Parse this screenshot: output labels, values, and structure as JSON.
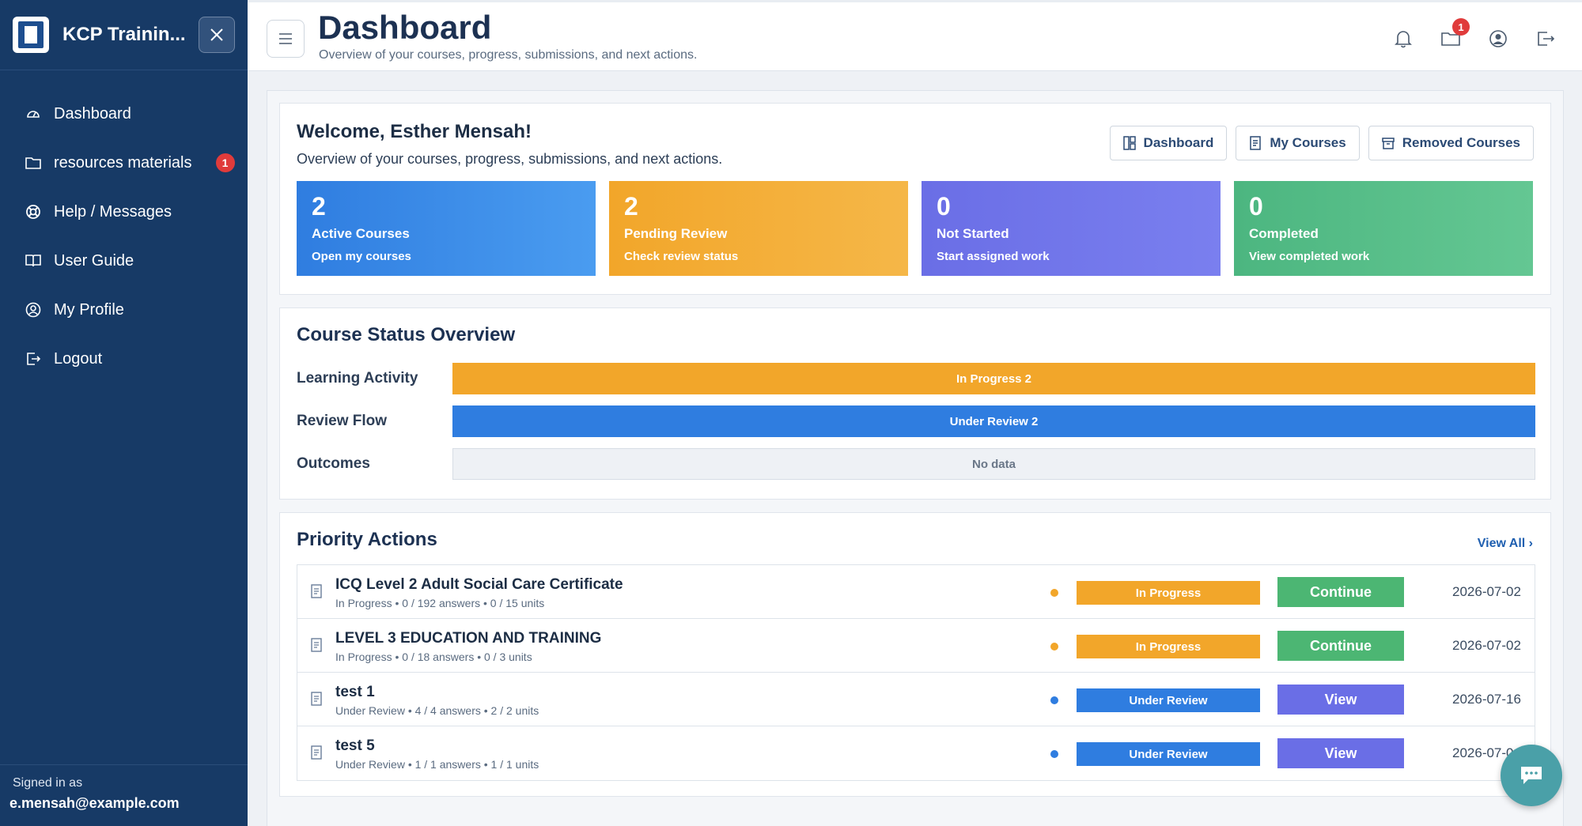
{
  "sidebar": {
    "brand": "KCP Trainin...",
    "items": [
      {
        "label": "Dashboard",
        "icon": "dashboard-icon"
      },
      {
        "label": "resources materials",
        "icon": "folder-icon",
        "badge": "1"
      },
      {
        "label": "Help / Messages",
        "icon": "lifebuoy-icon"
      },
      {
        "label": "User Guide",
        "icon": "book-icon"
      },
      {
        "label": "My Profile",
        "icon": "user-circle-icon"
      },
      {
        "label": "Logout",
        "icon": "logout-icon"
      }
    ],
    "signed_in_label": "Signed in as",
    "email": "e.mensah@example.com"
  },
  "header": {
    "title": "Dashboard",
    "subtitle": "Overview of your courses, progress, submissions, and next actions.",
    "folder_badge": "1"
  },
  "welcome": {
    "title": "Welcome, Esther Mensah!",
    "subtitle": "Overview of your courses, progress, submissions, and next actions.",
    "buttons": [
      "Dashboard",
      "My Courses",
      "Removed Courses"
    ]
  },
  "stats": [
    {
      "value": "2",
      "title": "Active Courses",
      "link": "Open my courses",
      "color": "#2f7de0"
    },
    {
      "value": "2",
      "title": "Pending Review",
      "link": "Check review status",
      "color": "#f2a62a"
    },
    {
      "value": "0",
      "title": "Not Started",
      "link": "Start assigned work",
      "color": "#6a6ee6"
    },
    {
      "value": "0",
      "title": "Completed",
      "link": "View completed work",
      "color": "#4cb680"
    }
  ],
  "status_overview": {
    "title": "Course Status Overview",
    "rows": [
      {
        "label": "Learning Activity",
        "bar": "In Progress 2"
      },
      {
        "label": "Review Flow",
        "bar": "Under Review 2"
      },
      {
        "label": "Outcomes",
        "bar": "No data"
      }
    ]
  },
  "priority": {
    "title": "Priority Actions",
    "view_all": "View All ›",
    "rows": [
      {
        "title": "ICQ Level 2 Adult Social Care Certificate",
        "meta": "In Progress • 0 / 192 answers • 0 / 15 units",
        "status": "In Progress",
        "action": "Continue",
        "date": "2026-07-02"
      },
      {
        "title": "LEVEL 3 EDUCATION AND TRAINING",
        "meta": "In Progress • 0 / 18 answers • 0 / 3 units",
        "status": "In Progress",
        "action": "Continue",
        "date": "2026-07-02"
      },
      {
        "title": "test 1",
        "meta": "Under Review • 4 / 4 answers • 2 / 2 units",
        "status": "Under Review",
        "action": "View",
        "date": "2026-07-16"
      },
      {
        "title": "test 5",
        "meta": "Under Review • 1 / 1 answers • 1 / 1 units",
        "status": "Under Review",
        "action": "View",
        "date": "2026-07-0"
      }
    ]
  }
}
